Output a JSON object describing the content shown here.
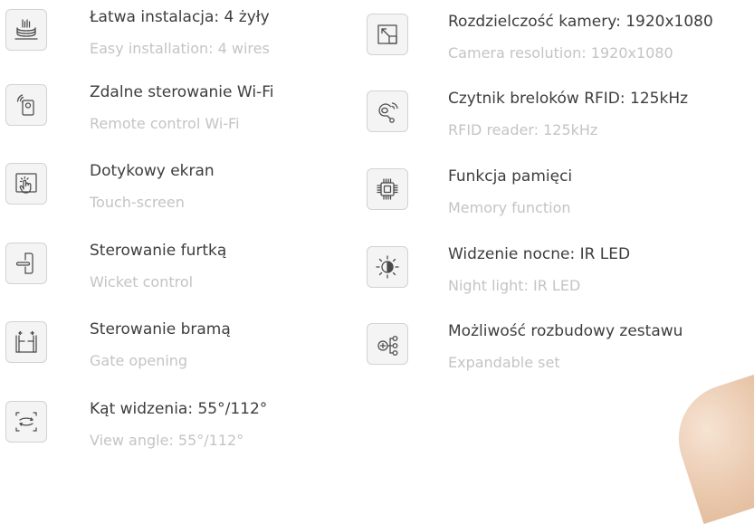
{
  "features_left": [
    {
      "pl": "Łatwa instalacja: 4 żyły",
      "en": "Easy installation: 4 wires",
      "icon": "wires-icon"
    },
    {
      "pl": "Zdalne sterowanie Wi-Fi",
      "en": "Remote control Wi-Fi",
      "icon": "wifi-remote-icon"
    },
    {
      "pl": "Dotykowy ekran",
      "en": "Touch-screen",
      "icon": "touch-screen-icon"
    },
    {
      "pl": "Sterowanie furtką",
      "en": "Wicket control",
      "icon": "door-handle-icon"
    },
    {
      "pl": "Sterowanie bramą",
      "en": "Gate opening",
      "icon": "gate-icon"
    },
    {
      "pl": "Kąt widzenia: 55°/112°",
      "en": "View angle: 55°/112°",
      "icon": "view-angle-icon"
    }
  ],
  "features_right": [
    {
      "pl": "Rozdzielczość kamery: 1920x1080",
      "en": "Camera resolution: 1920x1080",
      "icon": "resolution-icon"
    },
    {
      "pl": "Czytnik breloków RFID: 125kHz",
      "en": "RFID reader: 125kHz",
      "icon": "rfid-icon"
    },
    {
      "pl": "Funkcja pamięci",
      "en": "Memory function",
      "icon": "memory-chip-icon"
    },
    {
      "pl": "Widzenie nocne: IR LED",
      "en": "Night light: IR LED",
      "icon": "night-vision-icon"
    },
    {
      "pl": "Możliwość rozbudowy zestawu",
      "en": "Expandable set",
      "icon": "expandable-icon"
    }
  ],
  "colors": {
    "primary_text": "#3d3d3d",
    "secondary_text": "#c4c4c4",
    "icon_stroke": "#4a4a4a",
    "icon_border": "#d2d2d2"
  }
}
